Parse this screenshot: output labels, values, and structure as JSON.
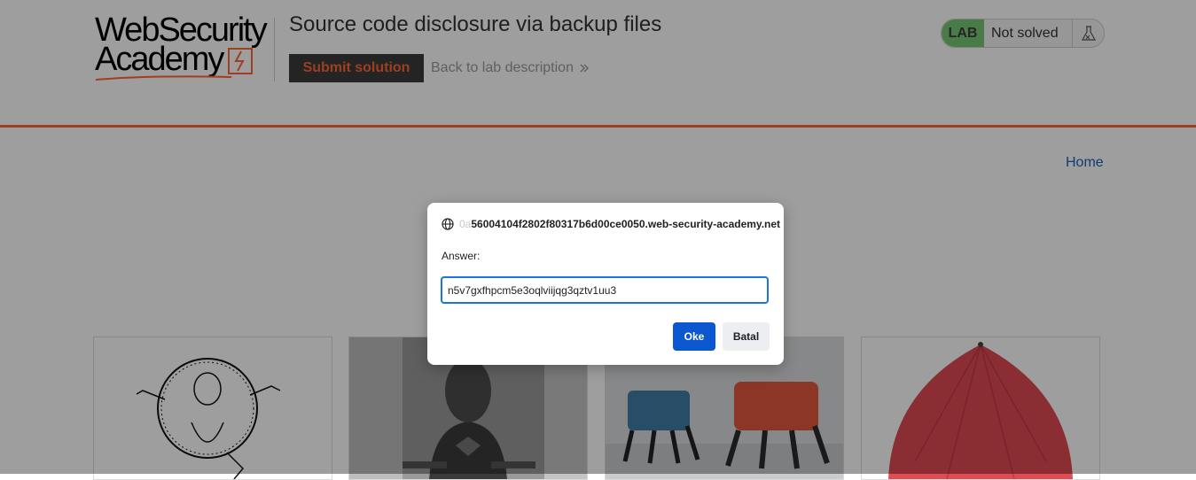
{
  "header": {
    "logo_line1": "WebSecurity",
    "logo_line2": "Academy",
    "lab_title": "Source code disclosure via backup files",
    "submit_label": "Submit solution",
    "back_label": "Back to lab description",
    "status": {
      "badge": "LAB",
      "text": "Not solved"
    }
  },
  "nav": {
    "home_label": "Home"
  },
  "dialog": {
    "origin_prefix": "0a",
    "origin_host": "56004104f2802f80317b6d00ce0050.web-security-academy.net",
    "label": "Answer:",
    "value": "n5v7gxfhpcm5e3oqlviijqg3qztv1uu3",
    "ok_label": "Oke",
    "cancel_label": "Batal"
  },
  "thumbnails": [
    {
      "name": "drawing-thumbnail"
    },
    {
      "name": "superhero-thumbnail"
    },
    {
      "name": "robots-thumbnail"
    },
    {
      "name": "umbrella-thumbnail"
    }
  ],
  "colors": {
    "accent": "#ff6633",
    "badge_green": "#76c775",
    "link_blue": "#1a63b8",
    "primary_button": "#0b57d0"
  }
}
